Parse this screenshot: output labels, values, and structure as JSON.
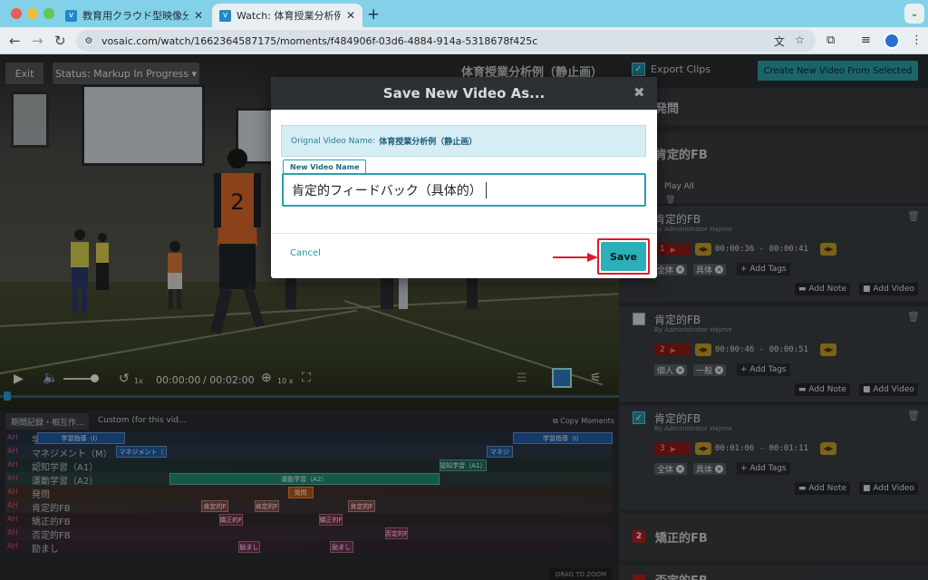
{
  "browser": {
    "tabs": [
      {
        "title": "教育用クラウド型映像分析ソフト",
        "favicon": "v",
        "active": false
      },
      {
        "title": "Watch: 体育授業分析例（静止画）",
        "favicon": "v",
        "active": true
      }
    ],
    "new_tab": "+",
    "url": "vosaic.com/watch/1662364587175/moments/f484906f-03d6-4884-914a-5318678f425c",
    "colors": {
      "tabbar": "#82d1e8",
      "toolbar": "#e9eef2"
    }
  },
  "player": {
    "exit_label": "Exit",
    "status_label": "Status: Markup In Progress ▾",
    "current_time": "00:00:00",
    "duration": "/ 00:02:00",
    "zoom_label": "10 x",
    "skip_label": "1x",
    "progress": 0.0
  },
  "timeline": {
    "tabs": [
      "期間記録・相互作...",
      "Custom (for this vid..."
    ],
    "copy_moments": "Copy Moments",
    "drag_to_zoom": "DRAG TO ZOOM",
    "rows": [
      {
        "ah": "AH",
        "label": "学習指導（I）",
        "color": "#1f5ea8",
        "segments": [
          {
            "text": "学習指導（I）",
            "start": 0.02,
            "end": 0.17
          },
          {
            "text": "学習指導（I）",
            "start": 0.83,
            "end": 1.0
          }
        ]
      },
      {
        "ah": "AH",
        "label": "マネジメント（M）",
        "color": "#1f5ea8",
        "segments": [
          {
            "text": "マネジメント（",
            "start": 0.155,
            "end": 0.24
          },
          {
            "text": "マネジ",
            "start": 0.785,
            "end": 0.83
          }
        ]
      },
      {
        "ah": "AH",
        "label": "認知学習（A1）",
        "color": "#1e7064",
        "segments": [
          {
            "text": "認知学習（A1）",
            "start": 0.705,
            "end": 0.785
          }
        ]
      },
      {
        "ah": "AH",
        "label": "運動学習（A2）",
        "color": "#1f8f77",
        "segments": [
          {
            "text": "運動学習（A2）",
            "start": 0.245,
            "end": 0.705
          }
        ]
      },
      {
        "ah": "AH",
        "label": "発問",
        "color": "#b85a1a",
        "segments": [
          {
            "text": "発問",
            "start": 0.447,
            "end": 0.49
          }
        ]
      },
      {
        "ah": "AH",
        "label": "肯定的FB",
        "color": "#8a4a4a",
        "segments": [
          {
            "text": "肯定的F",
            "start": 0.3,
            "end": 0.345
          },
          {
            "text": "肯定的F",
            "start": 0.39,
            "end": 0.432
          },
          {
            "text": "肯定的F",
            "start": 0.55,
            "end": 0.595
          }
        ]
      },
      {
        "ah": "AH",
        "label": "矯正的FB",
        "color": "#7a2a3e",
        "segments": [
          {
            "text": "矯正的F",
            "start": 0.33,
            "end": 0.37
          },
          {
            "text": "矯正的F",
            "start": 0.5,
            "end": 0.54
          }
        ]
      },
      {
        "ah": "AH",
        "label": "否定的FB",
        "color": "#7a2a4a",
        "segments": [
          {
            "text": "否定的F",
            "start": 0.612,
            "end": 0.652
          }
        ]
      },
      {
        "ah": "AH",
        "label": "励まし",
        "color": "#7a2a5a",
        "segments": [
          {
            "text": "励まし",
            "start": 0.362,
            "end": 0.4
          },
          {
            "text": "励まし",
            "start": 0.518,
            "end": 0.558
          }
        ]
      }
    ]
  },
  "panel": {
    "video_title": "体育授業分析例（静止画）",
    "export_clips": "Export Clips",
    "export_checked": true,
    "create_button": "Create New Video From Selected",
    "category_1": "発問",
    "category_2": "肯定的FB",
    "play_all": "Play All",
    "clips": [
      {
        "title": "肯定的FB",
        "by": "By Administrator Hajime",
        "num": "1",
        "time": "00:00:36 - 00:00:41",
        "tags": [
          "全体",
          "具体"
        ],
        "checked": null
      },
      {
        "title": "肯定的FB",
        "by": "By Administrator Hajime",
        "num": "2",
        "time": "00:00:46 - 00:00:51",
        "tags": [
          "個人",
          "一般"
        ],
        "checked": false
      },
      {
        "title": "肯定的FB",
        "by": "By Administrator Hajime",
        "num": "3",
        "time": "00:01:06 - 00:01:11",
        "tags": [
          "全体",
          "具体"
        ],
        "checked": true
      }
    ],
    "add_tags": "+ Add Tags",
    "add_note": "Add Note",
    "add_video": "Add Video",
    "category_3_num": "2",
    "category_3": "矯正的FB",
    "category_4": "否定的FB"
  },
  "modal": {
    "title": "Save New Video As...",
    "close": "✖",
    "original_label": "Orignal Video Name:",
    "original_name": "体育授業分析例（静止画）",
    "new_name_label": "New Video Name",
    "new_name_value": "肯定的フィードバック（具体的）",
    "cancel": "Cancel",
    "save": "Save",
    "accent": "#2ab0b6",
    "highlight": "#e0182c"
  }
}
